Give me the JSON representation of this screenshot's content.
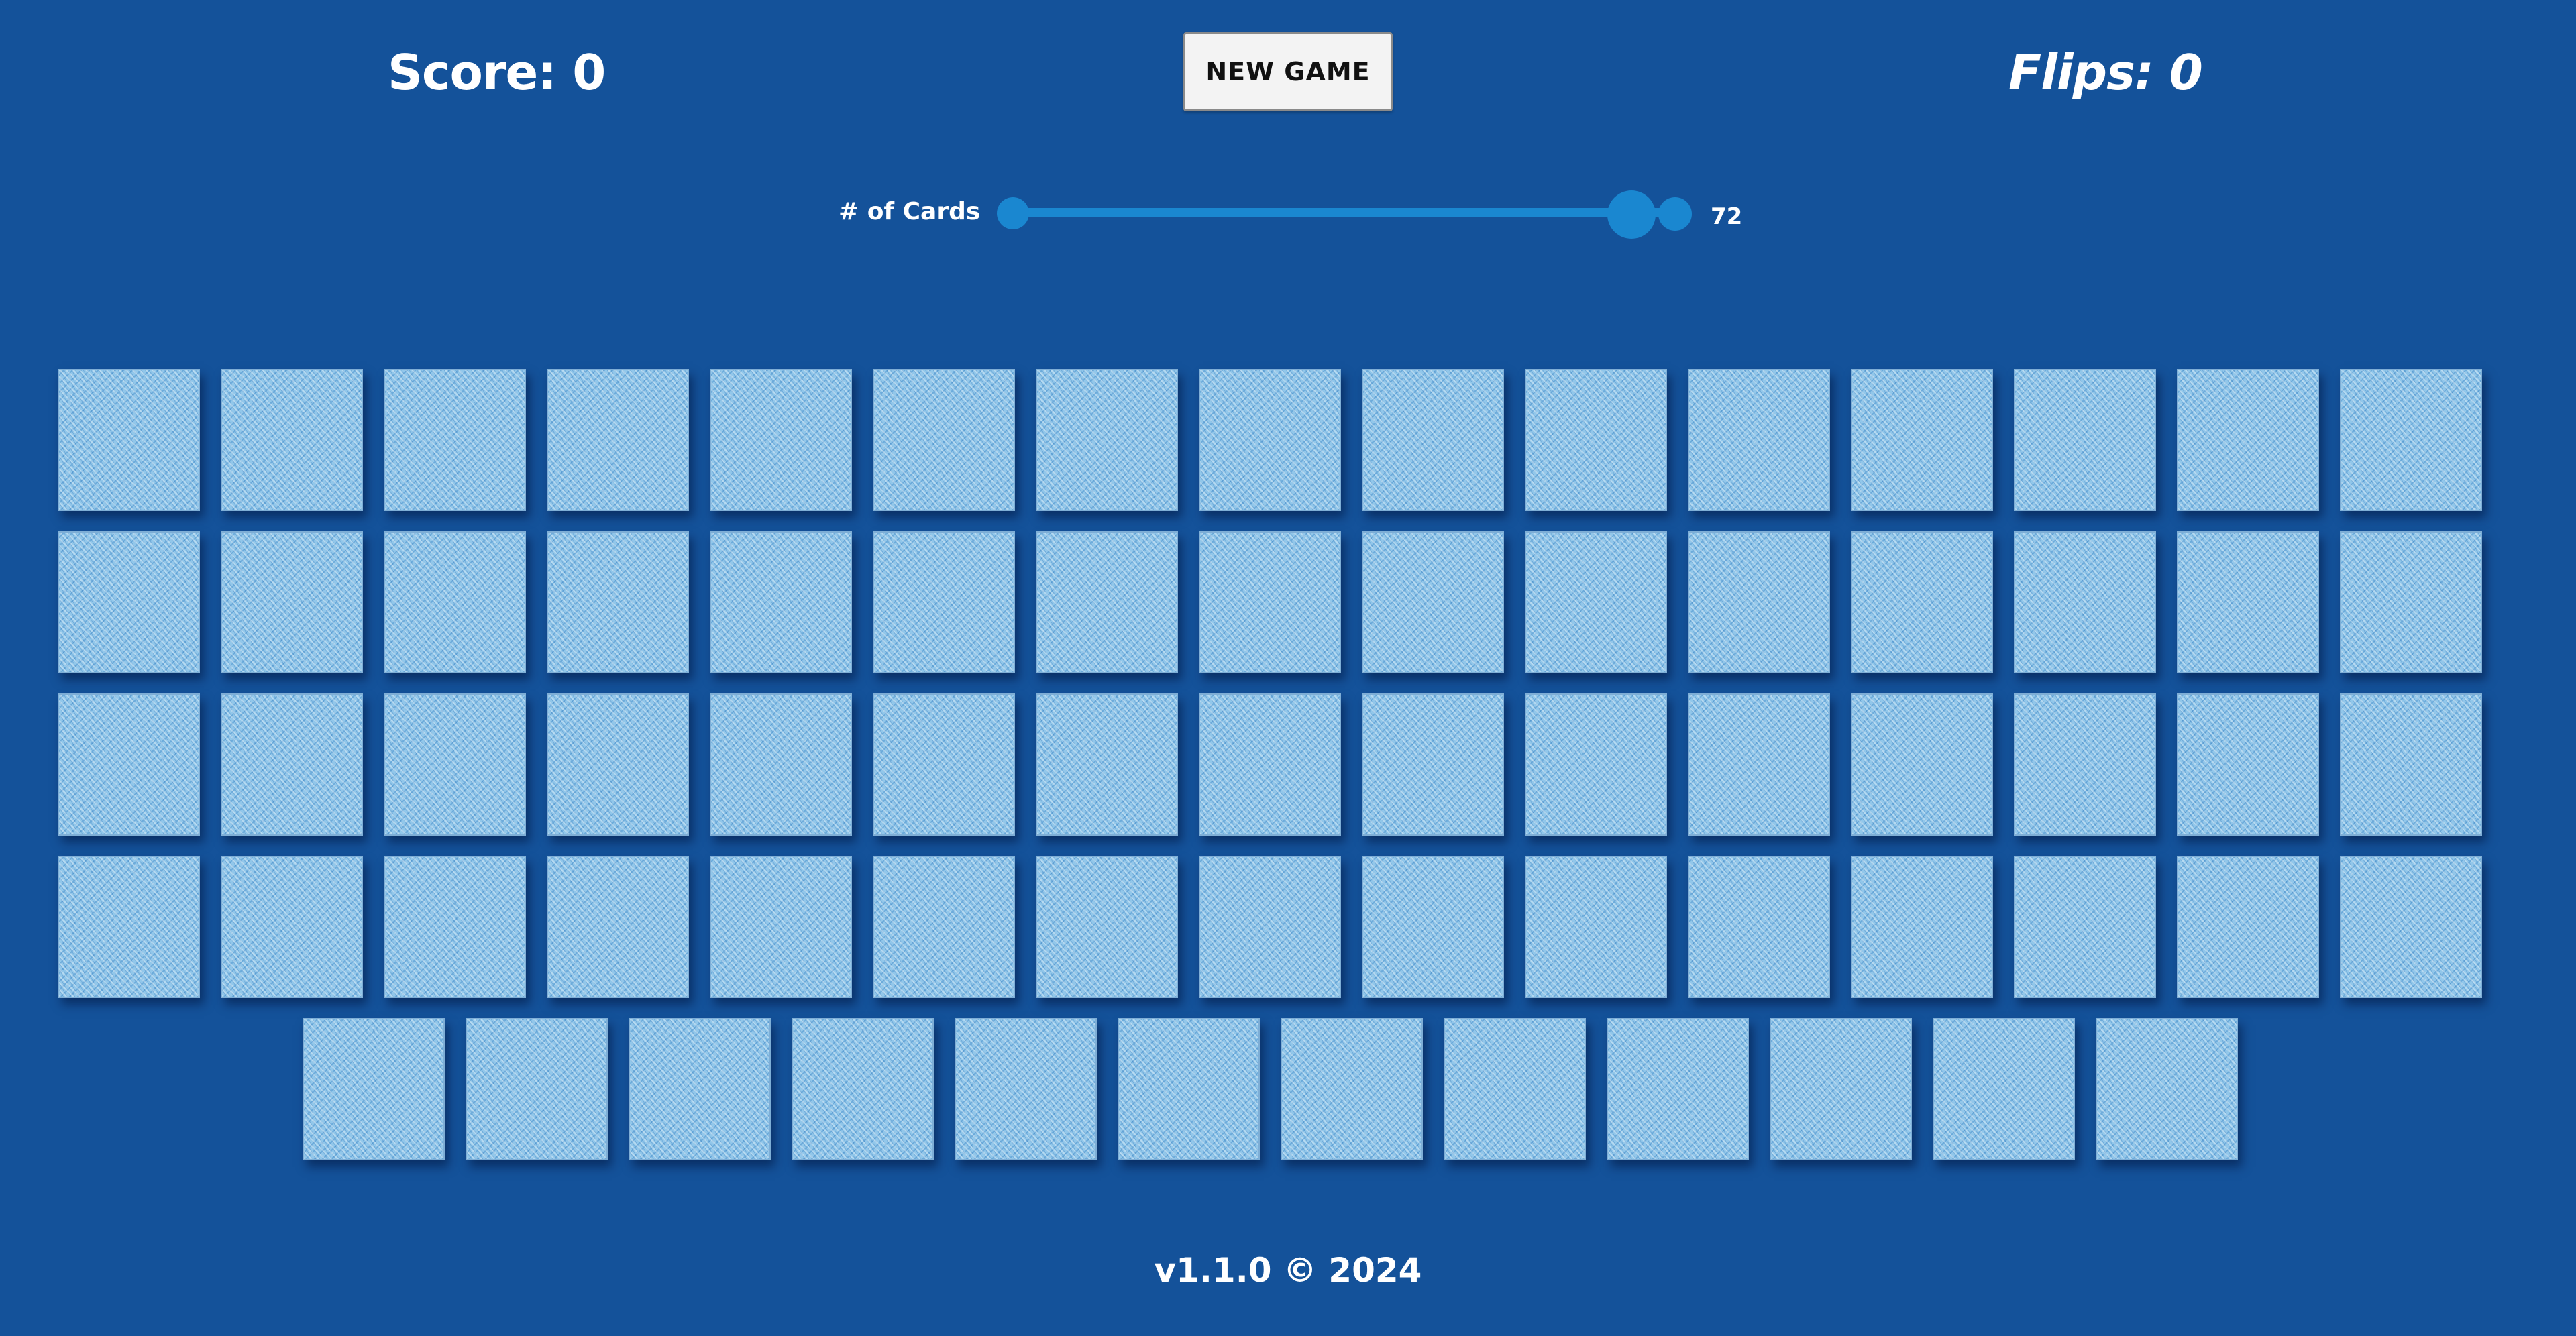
{
  "colors": {
    "background": "#14529a",
    "card_face": "#92c7ea",
    "slider": "#1a87d0",
    "button_background": "#f3f3f3",
    "text": "#ffffff"
  },
  "header": {
    "score_text": "Score: 0",
    "new_game_label": "NEW GAME",
    "flips_text": "Flips: 0"
  },
  "slider": {
    "label": "# of Cards",
    "value": "72",
    "level": 0.96
  },
  "board": {
    "card_count": 72,
    "card_state": "face-down"
  },
  "footer": {
    "text": "v1.1.0 © 2024"
  }
}
